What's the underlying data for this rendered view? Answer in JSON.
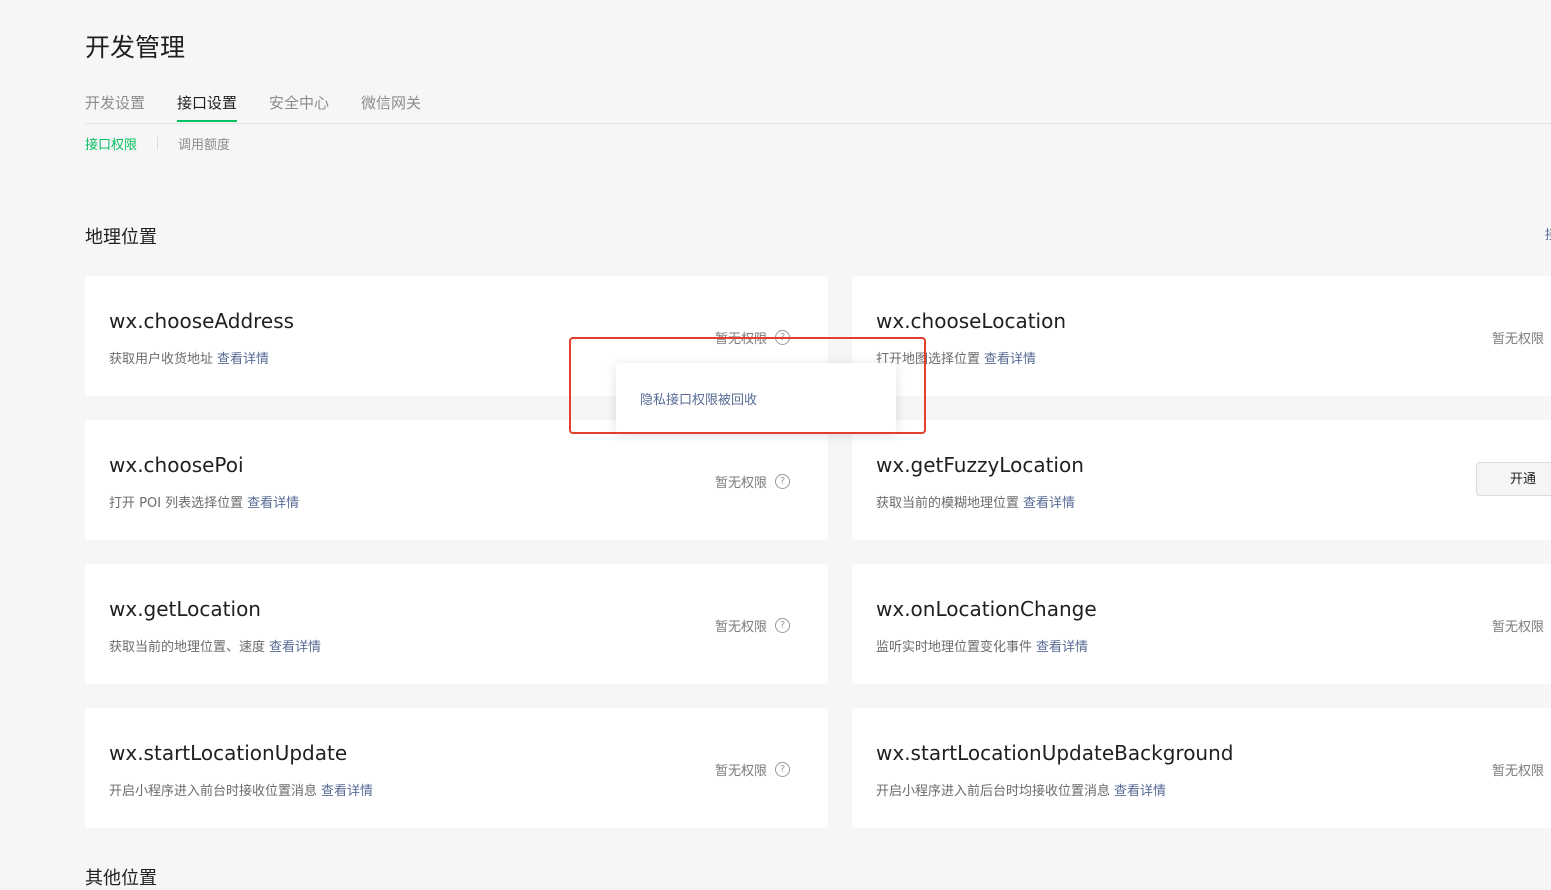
{
  "page": {
    "title": "开发管理"
  },
  "tabs": [
    "开发设置",
    "接口设置",
    "安全中心",
    "微信网关"
  ],
  "active_tab": "接口设置",
  "subtabs": [
    "接口权限",
    "调用额度"
  ],
  "active_subtab": "接口权限",
  "section": {
    "title": "地理位置",
    "edge_action": "接"
  },
  "link_label": "查看详情",
  "cards": [
    {
      "name": "wx.chooseAddress",
      "desc": "获取用户收货地址",
      "status": "暂无权限"
    },
    {
      "name": "wx.chooseLocation",
      "desc": "打开地图选择位置",
      "status": "暂无权限"
    },
    {
      "name": "wx.choosePoi",
      "desc": "打开 POI 列表选择位置",
      "status": "暂无权限"
    },
    {
      "name": "wx.getFuzzyLocation",
      "desc": "获取当前的模糊地理位置",
      "button": "开通"
    },
    {
      "name": "wx.getLocation",
      "desc": "获取当前的地理位置、速度",
      "status": "暂无权限"
    },
    {
      "name": "wx.onLocationChange",
      "desc": "监听实时地理位置变化事件",
      "status": "暂无权限"
    },
    {
      "name": "wx.startLocationUpdate",
      "desc": "开启小程序进入前台时接收位置消息",
      "status": "暂无权限"
    },
    {
      "name": "wx.startLocationUpdateBackground",
      "desc": "开启小程序进入前后台时均接收位置消息",
      "status": "暂无权限"
    }
  ],
  "tooltip": {
    "text": "隐私接口权限被回收"
  },
  "next_section": {
    "title": "其他位置"
  },
  "colors": {
    "accent": "#07c160",
    "link": "#576b95",
    "highlight": "#e0412e"
  },
  "icons": {
    "help": "question-circle-icon"
  }
}
